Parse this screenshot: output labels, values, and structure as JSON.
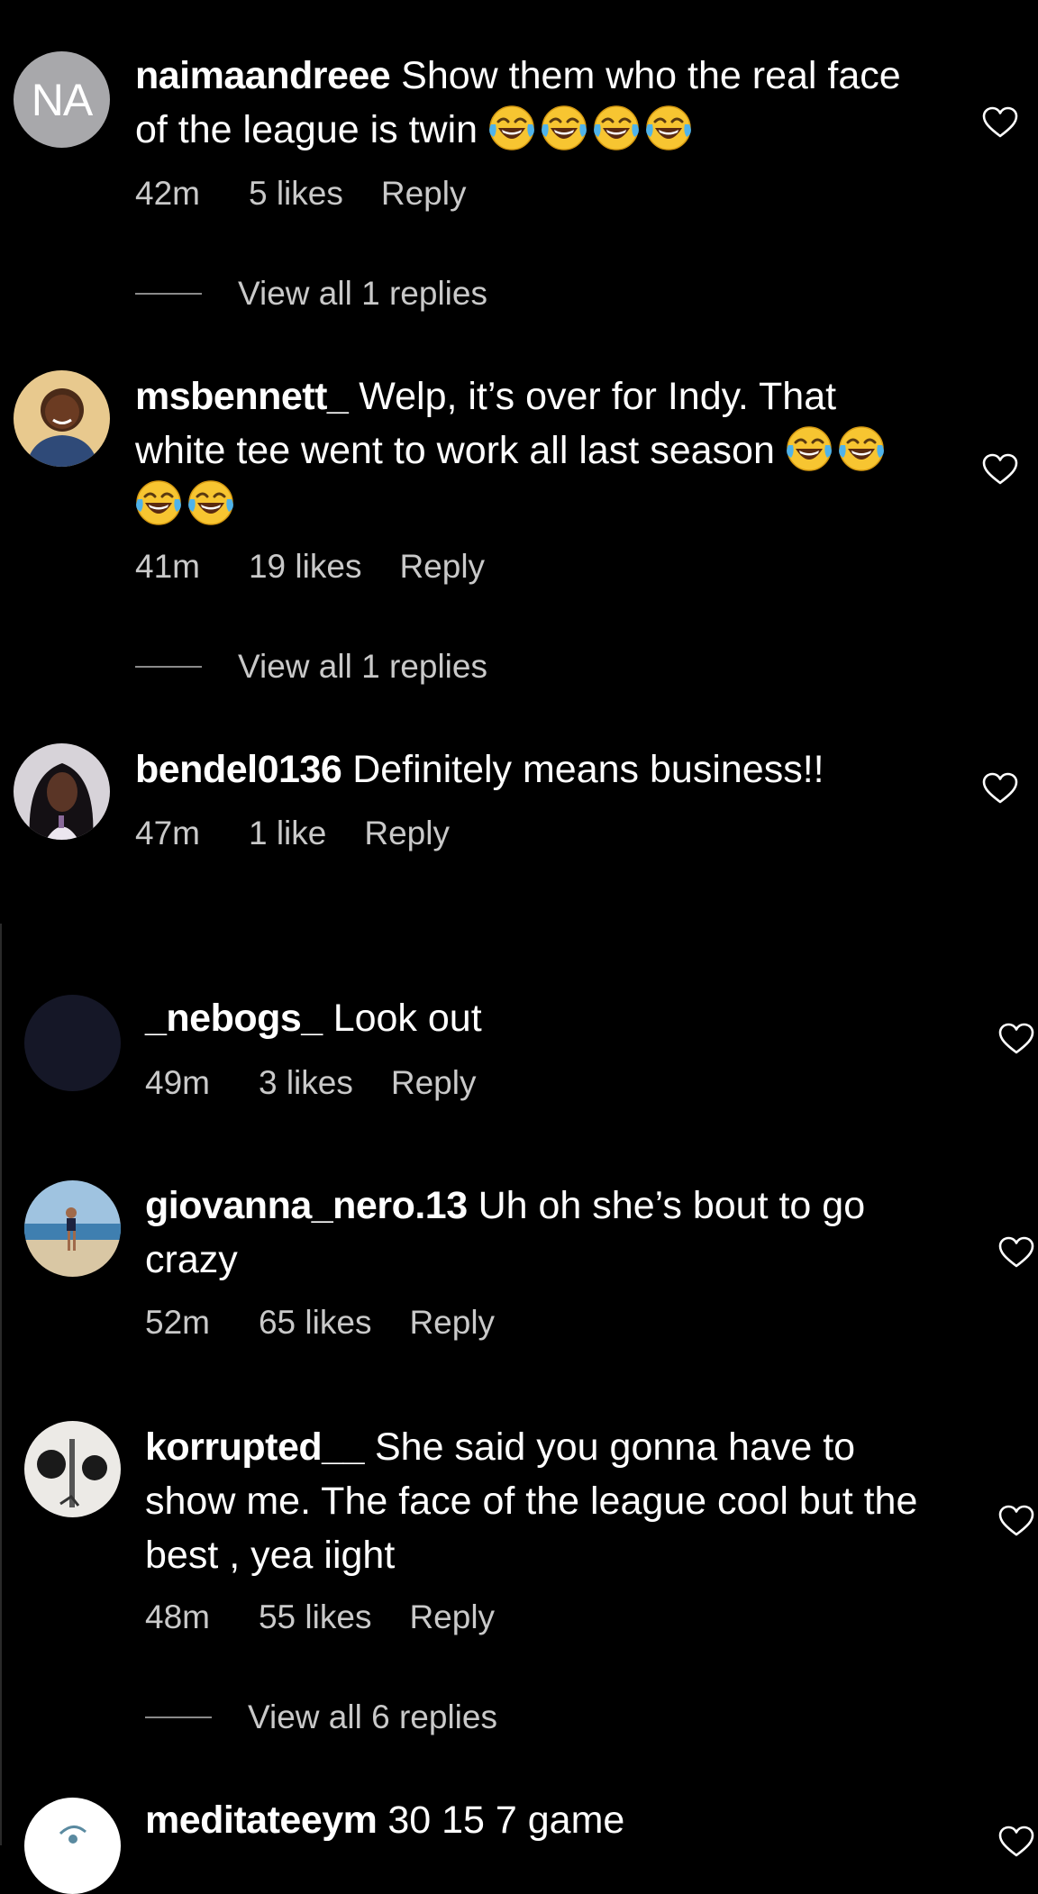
{
  "comments": [
    {
      "username": "naimaandreee",
      "text": "Show them who the real face of the league is twin",
      "emoji_count": 4,
      "emoji": "face-with-tears-of-joy",
      "time": "42m",
      "likes": "5 likes",
      "reply": "Reply",
      "view_replies": "View all 1 replies",
      "avatar_initials": "NA"
    },
    {
      "username": "msbennett_",
      "text": "Welp, it’s over for Indy. That white tee went to work all last season",
      "emoji_count": 4,
      "emoji": "face-with-tears-of-joy",
      "time": "41m",
      "likes": "19 likes",
      "reply": "Reply",
      "view_replies": "View all 1 replies"
    },
    {
      "username": "bendel0136",
      "text": "Definitely means business!!",
      "time": "47m",
      "likes": "1 like",
      "reply": "Reply"
    },
    {
      "username": "_nebogs_",
      "text": "Look out",
      "time": "49m",
      "likes": "3 likes",
      "reply": "Reply"
    },
    {
      "username": "giovanna_nero.13",
      "text": "Uh oh she’s bout to go crazy",
      "time": "52m",
      "likes": "65 likes",
      "reply": "Reply"
    },
    {
      "username": "korrupted__",
      "text": "She said you gonna have to show me. The face of the league cool but the best , yea iight",
      "time": "48m",
      "likes": "55 likes",
      "reply": "Reply",
      "view_replies": "View all 6 replies"
    },
    {
      "username": "meditateeym",
      "text": "30 15 7 game"
    }
  ],
  "colors": {
    "background": "#000000",
    "text": "#ffffff",
    "meta": "#c9c9c9",
    "avatar_initials_bg": "#a8a8ab"
  },
  "icons": {
    "like": "heart-outline-icon",
    "emoji": "face-with-tears-of-joy"
  }
}
